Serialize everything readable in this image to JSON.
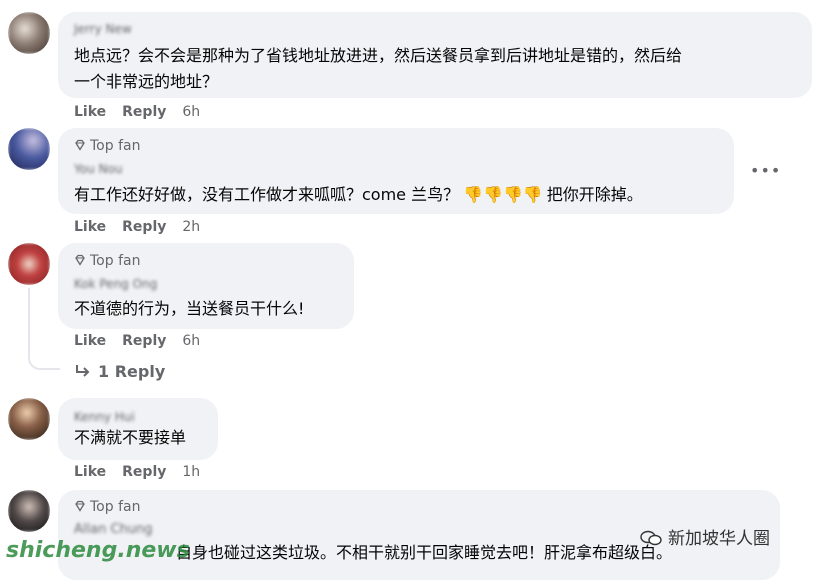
{
  "comments": [
    {
      "name": "Jerry New",
      "badge": "",
      "text1": "地点远？会不会是那种为了省钱地址放进进，然后送餐员拿到后讲地址是错的，然后给",
      "text2": "一个非常远的地址？",
      "like": "Like",
      "reply": "Reply",
      "time": "6h"
    },
    {
      "name": "You Nou",
      "badge": "Top fan",
      "text1": "有工作还好好做，没有工作做才来呱呱？come 兰鸟？",
      "thumbs": "👎👎👎👎",
      "text_after": "把你开除掉。",
      "like": "Like",
      "reply": "Reply",
      "time": "2h"
    },
    {
      "name": "Kok Peng Ong",
      "badge": "Top fan",
      "text1": "不道德的行为，当送餐员干什么!",
      "like": "Like",
      "reply": "Reply",
      "time": "6h",
      "replies_link": "1 Reply"
    },
    {
      "name": "Kenny Hui",
      "badge": "",
      "text1": "不满就不要接单",
      "like": "Like",
      "reply": "Reply",
      "time": "1h"
    },
    {
      "name": "Allan Chung",
      "badge": "Top fan",
      "text1": "自身也碰过这类垃圾。不相干就别干回家睡觉去吧！肝泥拿布超级白。"
    }
  ],
  "more_icon": "•••",
  "watermark": {
    "left": "shicheng.news",
    "right": "新加坡华人圈"
  }
}
